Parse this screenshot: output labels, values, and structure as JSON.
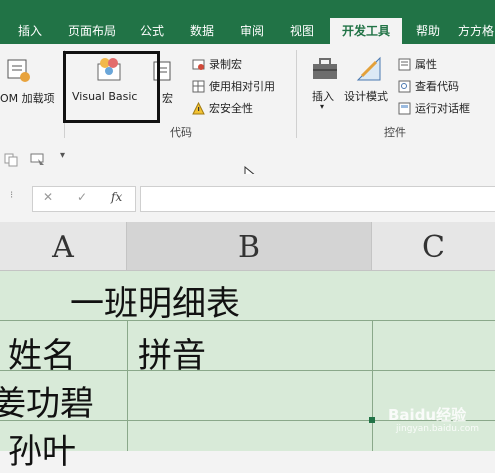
{
  "tabs": [
    "插入",
    "页面布局",
    "公式",
    "数据",
    "审阅",
    "视图",
    "开发工具",
    "帮助",
    "方方格"
  ],
  "active_tab_index": 6,
  "ribbon": {
    "com_addins": "OM 加载项",
    "visual_basic": "Visual Basic",
    "macros_partial": "宏",
    "record_macro": "录制宏",
    "use_relative": "使用相对引用",
    "macro_security": "宏安全性",
    "code_group": "代码",
    "insert": "插入",
    "design_mode": "设计模式",
    "properties": "属性",
    "view_code": "查看代码",
    "run_dialog": "运行对话框",
    "controls_group": "控件"
  },
  "formula_bar": {
    "cancel": "✕",
    "enter": "✓",
    "fx": "fx",
    "value": ""
  },
  "columns": [
    "A",
    "B",
    "C"
  ],
  "cells": {
    "title": "一班明细表",
    "header_name": "姓名",
    "header_pinyin": "拼音",
    "row1_name": "姜功碧",
    "row2_name": "孙叶"
  },
  "watermark": {
    "brand": "Baidu经验",
    "url": "jingyan.baidu.com"
  },
  "colors": {
    "ribbon_green": "#217346",
    "grid_fill": "#d8ead8"
  }
}
